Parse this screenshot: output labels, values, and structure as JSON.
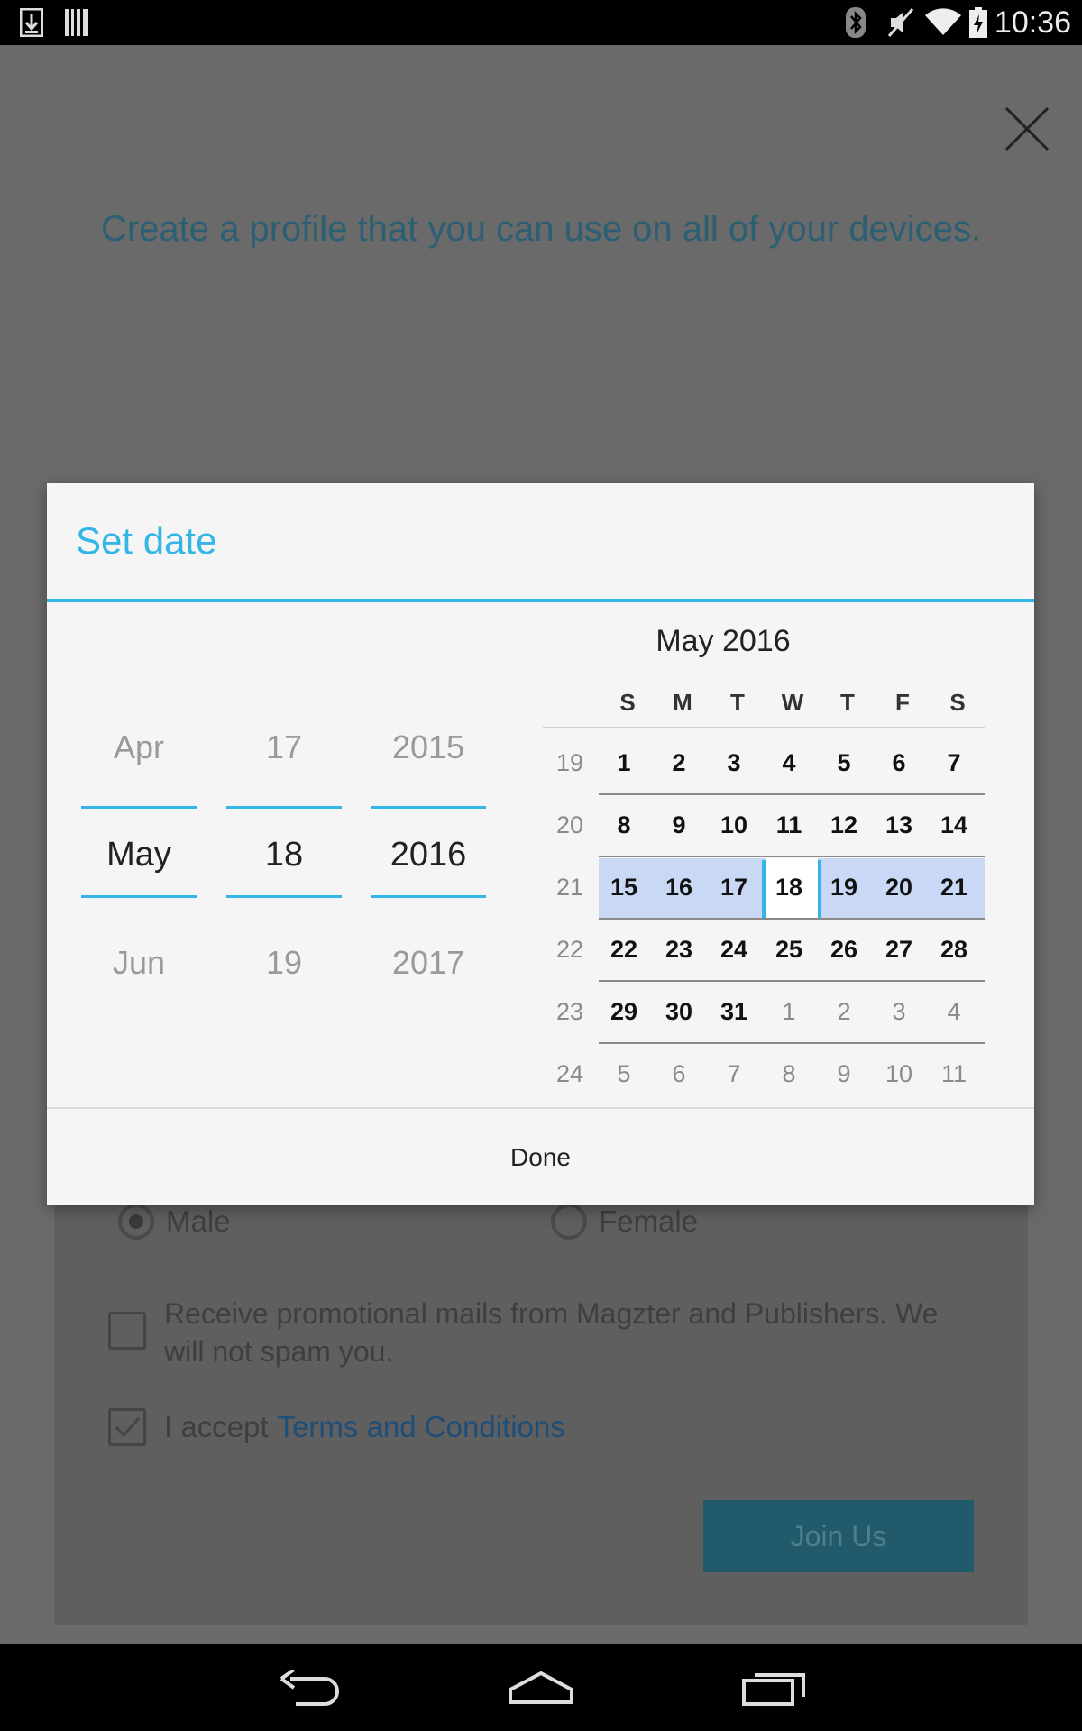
{
  "status_bar": {
    "time": "10:36",
    "left_icons": [
      "download-icon",
      "barcode-icon"
    ],
    "right_icons": [
      "bluetooth-icon",
      "mute-icon",
      "wifi-icon",
      "battery-icon"
    ]
  },
  "background": {
    "tagline": "Create a profile that you can use on all of your devices.",
    "gender_options": [
      {
        "label": "Male",
        "selected": true
      },
      {
        "label": "Female",
        "selected": false
      }
    ],
    "promo_text": "Receive promotional mails from Magzter and Publishers. We will not spam you.",
    "promo_checked": false,
    "terms_prefix": "I accept",
    "terms_link": "Terms and Conditions",
    "terms_checked": true,
    "join_button": "Join Us"
  },
  "dialog": {
    "title": "Set date",
    "spinners": {
      "month": {
        "prev": "Apr",
        "current": "May",
        "next": "Jun"
      },
      "day": {
        "prev": "17",
        "current": "18",
        "next": "19"
      },
      "year": {
        "prev": "2015",
        "current": "2016",
        "next": "2017"
      }
    },
    "calendar": {
      "header": "May 2016",
      "weekdays": [
        "S",
        "M",
        "T",
        "W",
        "T",
        "F",
        "S"
      ],
      "weeks": [
        {
          "num": "19",
          "days": [
            "1",
            "2",
            "3",
            "4",
            "5",
            "6",
            "7"
          ],
          "in_month": [
            true,
            true,
            true,
            true,
            true,
            true,
            true
          ]
        },
        {
          "num": "20",
          "days": [
            "8",
            "9",
            "10",
            "11",
            "12",
            "13",
            "14"
          ],
          "in_month": [
            true,
            true,
            true,
            true,
            true,
            true,
            true
          ]
        },
        {
          "num": "21",
          "days": [
            "15",
            "16",
            "17",
            "18",
            "19",
            "20",
            "21"
          ],
          "in_month": [
            true,
            true,
            true,
            true,
            true,
            true,
            true
          ]
        },
        {
          "num": "22",
          "days": [
            "22",
            "23",
            "24",
            "25",
            "26",
            "27",
            "28"
          ],
          "in_month": [
            true,
            true,
            true,
            true,
            true,
            true,
            true
          ]
        },
        {
          "num": "23",
          "days": [
            "29",
            "30",
            "31",
            "1",
            "2",
            "3",
            "4"
          ],
          "in_month": [
            true,
            true,
            true,
            false,
            false,
            false,
            false
          ]
        },
        {
          "num": "24",
          "days": [
            "5",
            "6",
            "7",
            "8",
            "9",
            "10",
            "11"
          ],
          "in_month": [
            false,
            false,
            false,
            false,
            false,
            false,
            false
          ]
        }
      ],
      "selected_day": "18"
    },
    "done_button": "Done"
  },
  "colors": {
    "accent": "#33b5e5",
    "selected_week": "#c8d8f5"
  },
  "nav_bar": {
    "icons": [
      "back-icon",
      "home-icon",
      "recents-icon"
    ]
  }
}
